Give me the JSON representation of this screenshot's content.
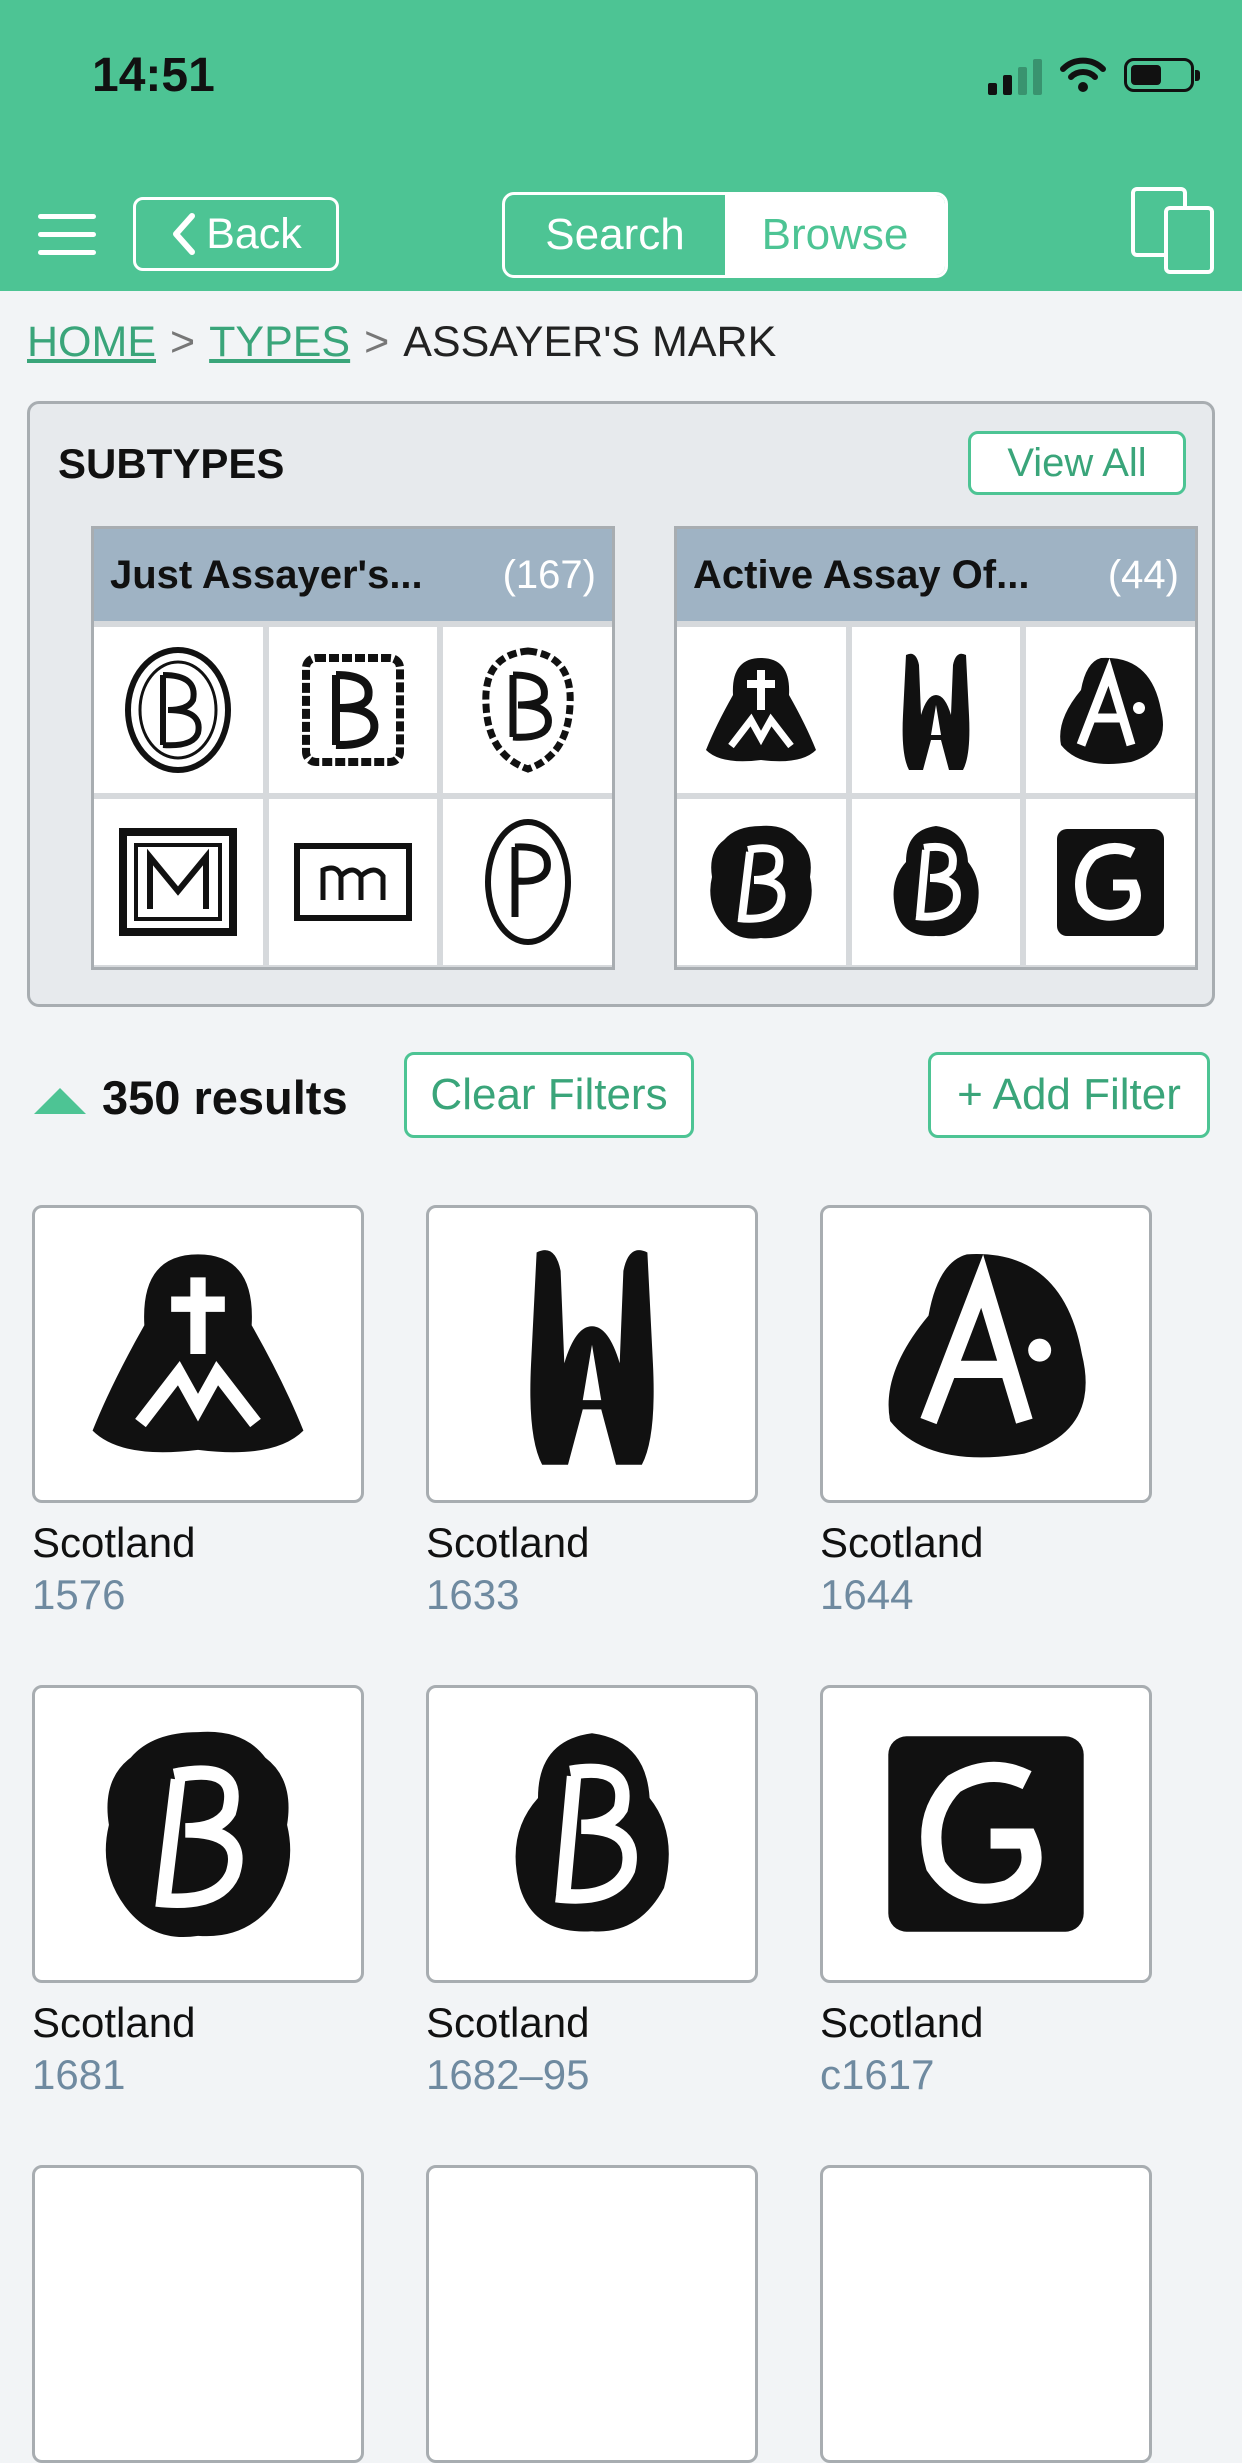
{
  "status": {
    "time": "14:51"
  },
  "nav": {
    "back_label": "Back",
    "search_label": "Search",
    "browse_label": "Browse",
    "accent": "#4dc494"
  },
  "breadcrumb": {
    "home": "HOME",
    "types": "TYPES",
    "current": "ASSAYER'S MARK",
    "sep": ">"
  },
  "subtypes": {
    "title": "SUBTYPES",
    "view_all": "View All",
    "cards": [
      {
        "name": "Just Assayer's...",
        "count": "(167)",
        "marks": [
          "B",
          "B",
          "B",
          "M",
          "m",
          "P"
        ]
      },
      {
        "name": "Active Assay Of...",
        "count": "(44)",
        "marks": [
          "anchor",
          "WA",
          "A",
          "B",
          "B",
          "G"
        ]
      }
    ]
  },
  "results": {
    "count": "350 results",
    "clear_filters": "Clear Filters",
    "add_filter": "+ Add Filter",
    "items": [
      {
        "region": "Scotland",
        "year": "1576",
        "mark": "anchor"
      },
      {
        "region": "Scotland",
        "year": "1633",
        "mark": "WA"
      },
      {
        "region": "Scotland",
        "year": "1644",
        "mark": "A"
      },
      {
        "region": "Scotland",
        "year": "1681",
        "mark": "B"
      },
      {
        "region": "Scotland",
        "year": "1682–95",
        "mark": "B"
      },
      {
        "region": "Scotland",
        "year": "c1617",
        "mark": "G"
      }
    ]
  }
}
